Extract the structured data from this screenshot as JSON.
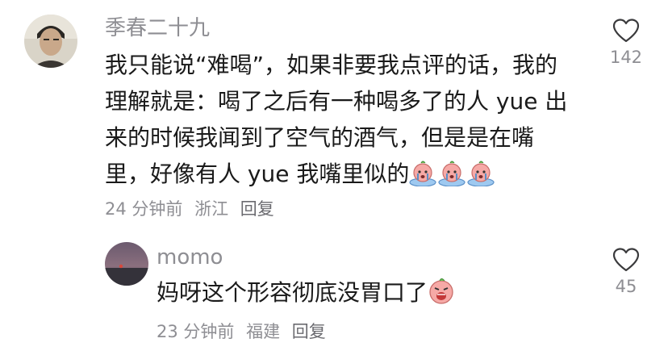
{
  "comments": [
    {
      "username": "季春二十九",
      "lines": [
        "我只能说“难喝”，如果非要我点评的话，我的",
        "理解就是：喝了之后有一种喝多了的人 yue 出",
        "来的时候我闻到了空气的酒气，但是是在嘴",
        "里，好像有人 yue 我嘴里似的"
      ],
      "emojis": [
        "crying-peach-emoji",
        "crying-peach-emoji",
        "crying-peach-emoji"
      ],
      "time": "24 分钟前",
      "location": "浙江",
      "reply": "回复",
      "likes": "142"
    },
    {
      "username": "momo",
      "lines": [
        "妈呀这个形容彻底没胃口了"
      ],
      "emojis": [
        "vomit-peach-emoji"
      ],
      "time": "23 分钟前",
      "location": "福建",
      "reply": "回复",
      "likes": "45"
    }
  ],
  "colors": {
    "username": "#8e8e93",
    "text": "#1a1a1a",
    "meta": "#8e8e93",
    "emoji_pink": "#f6a9a6",
    "emoji_blue": "#9ec9f0"
  },
  "icons": {
    "like": "heart-outline-icon"
  }
}
